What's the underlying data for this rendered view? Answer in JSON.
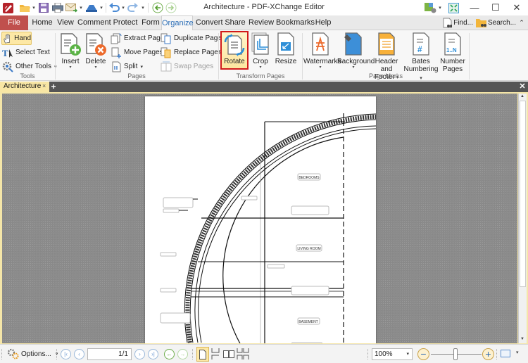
{
  "window": {
    "title": "Architecture - PDF-XChange Editor",
    "controls": {
      "minimize": "—",
      "maximize": "☐",
      "close": "✕"
    }
  },
  "quick_access": [
    {
      "name": "app-logo-icon"
    },
    {
      "name": "open-folder-icon"
    },
    {
      "name": "save-icon"
    },
    {
      "name": "print-icon"
    },
    {
      "name": "email-icon"
    },
    {
      "name": "scan-icon"
    },
    {
      "name": "undo-icon"
    },
    {
      "name": "redo-icon"
    },
    {
      "name": "back-icon"
    },
    {
      "name": "forward-icon"
    }
  ],
  "menu": {
    "file": "File",
    "tabs": [
      "Home",
      "View",
      "Comment",
      "Protect",
      "Form",
      "Organize",
      "Convert",
      "Share",
      "Review",
      "Bookmarks",
      "Help"
    ],
    "active_tab": "Organize",
    "find": "Find...",
    "search": "Search..."
  },
  "ribbon": {
    "tools": {
      "label": "Tools",
      "hand": "Hand",
      "select_text": "Select Text",
      "other_tools": "Other Tools"
    },
    "pages": {
      "label": "Pages",
      "insert": "Insert",
      "delete": "Delete",
      "extract": "Extract Pages",
      "move": "Move Pages",
      "split": "Split",
      "duplicate": "Duplicate Pages",
      "replace": "Replace Pages",
      "swap": "Swap Pages"
    },
    "transform": {
      "label": "Transform Pages",
      "rotate": "Rotate",
      "crop": "Crop",
      "resize": "Resize"
    },
    "marks": {
      "label": "Page Marks",
      "watermarks": "Watermarks",
      "background": "Background",
      "header_footer_1": "Header and",
      "header_footer_2": "Footer",
      "bates_1": "Bates",
      "bates_2": "Numbering",
      "number_1": "Number",
      "number_2": "Pages"
    }
  },
  "document_tabs": [
    {
      "label": "Architecture",
      "close": "×"
    }
  ],
  "new_tab": "+",
  "close_all": "✕",
  "drawing": {
    "rooms": [
      "BEDROOMS",
      "LIVING ROOM",
      "BASEMENT"
    ]
  },
  "status": {
    "options": "Options...",
    "page_value": "1/1",
    "zoom_value": "100%"
  },
  "colors": {
    "file_tab": "#c0504d",
    "active_tab_text": "#2a6db6",
    "highlight": "#fde8a5",
    "rotate_border": "#d11a1a",
    "doc_tab": "#f8e6a4"
  }
}
